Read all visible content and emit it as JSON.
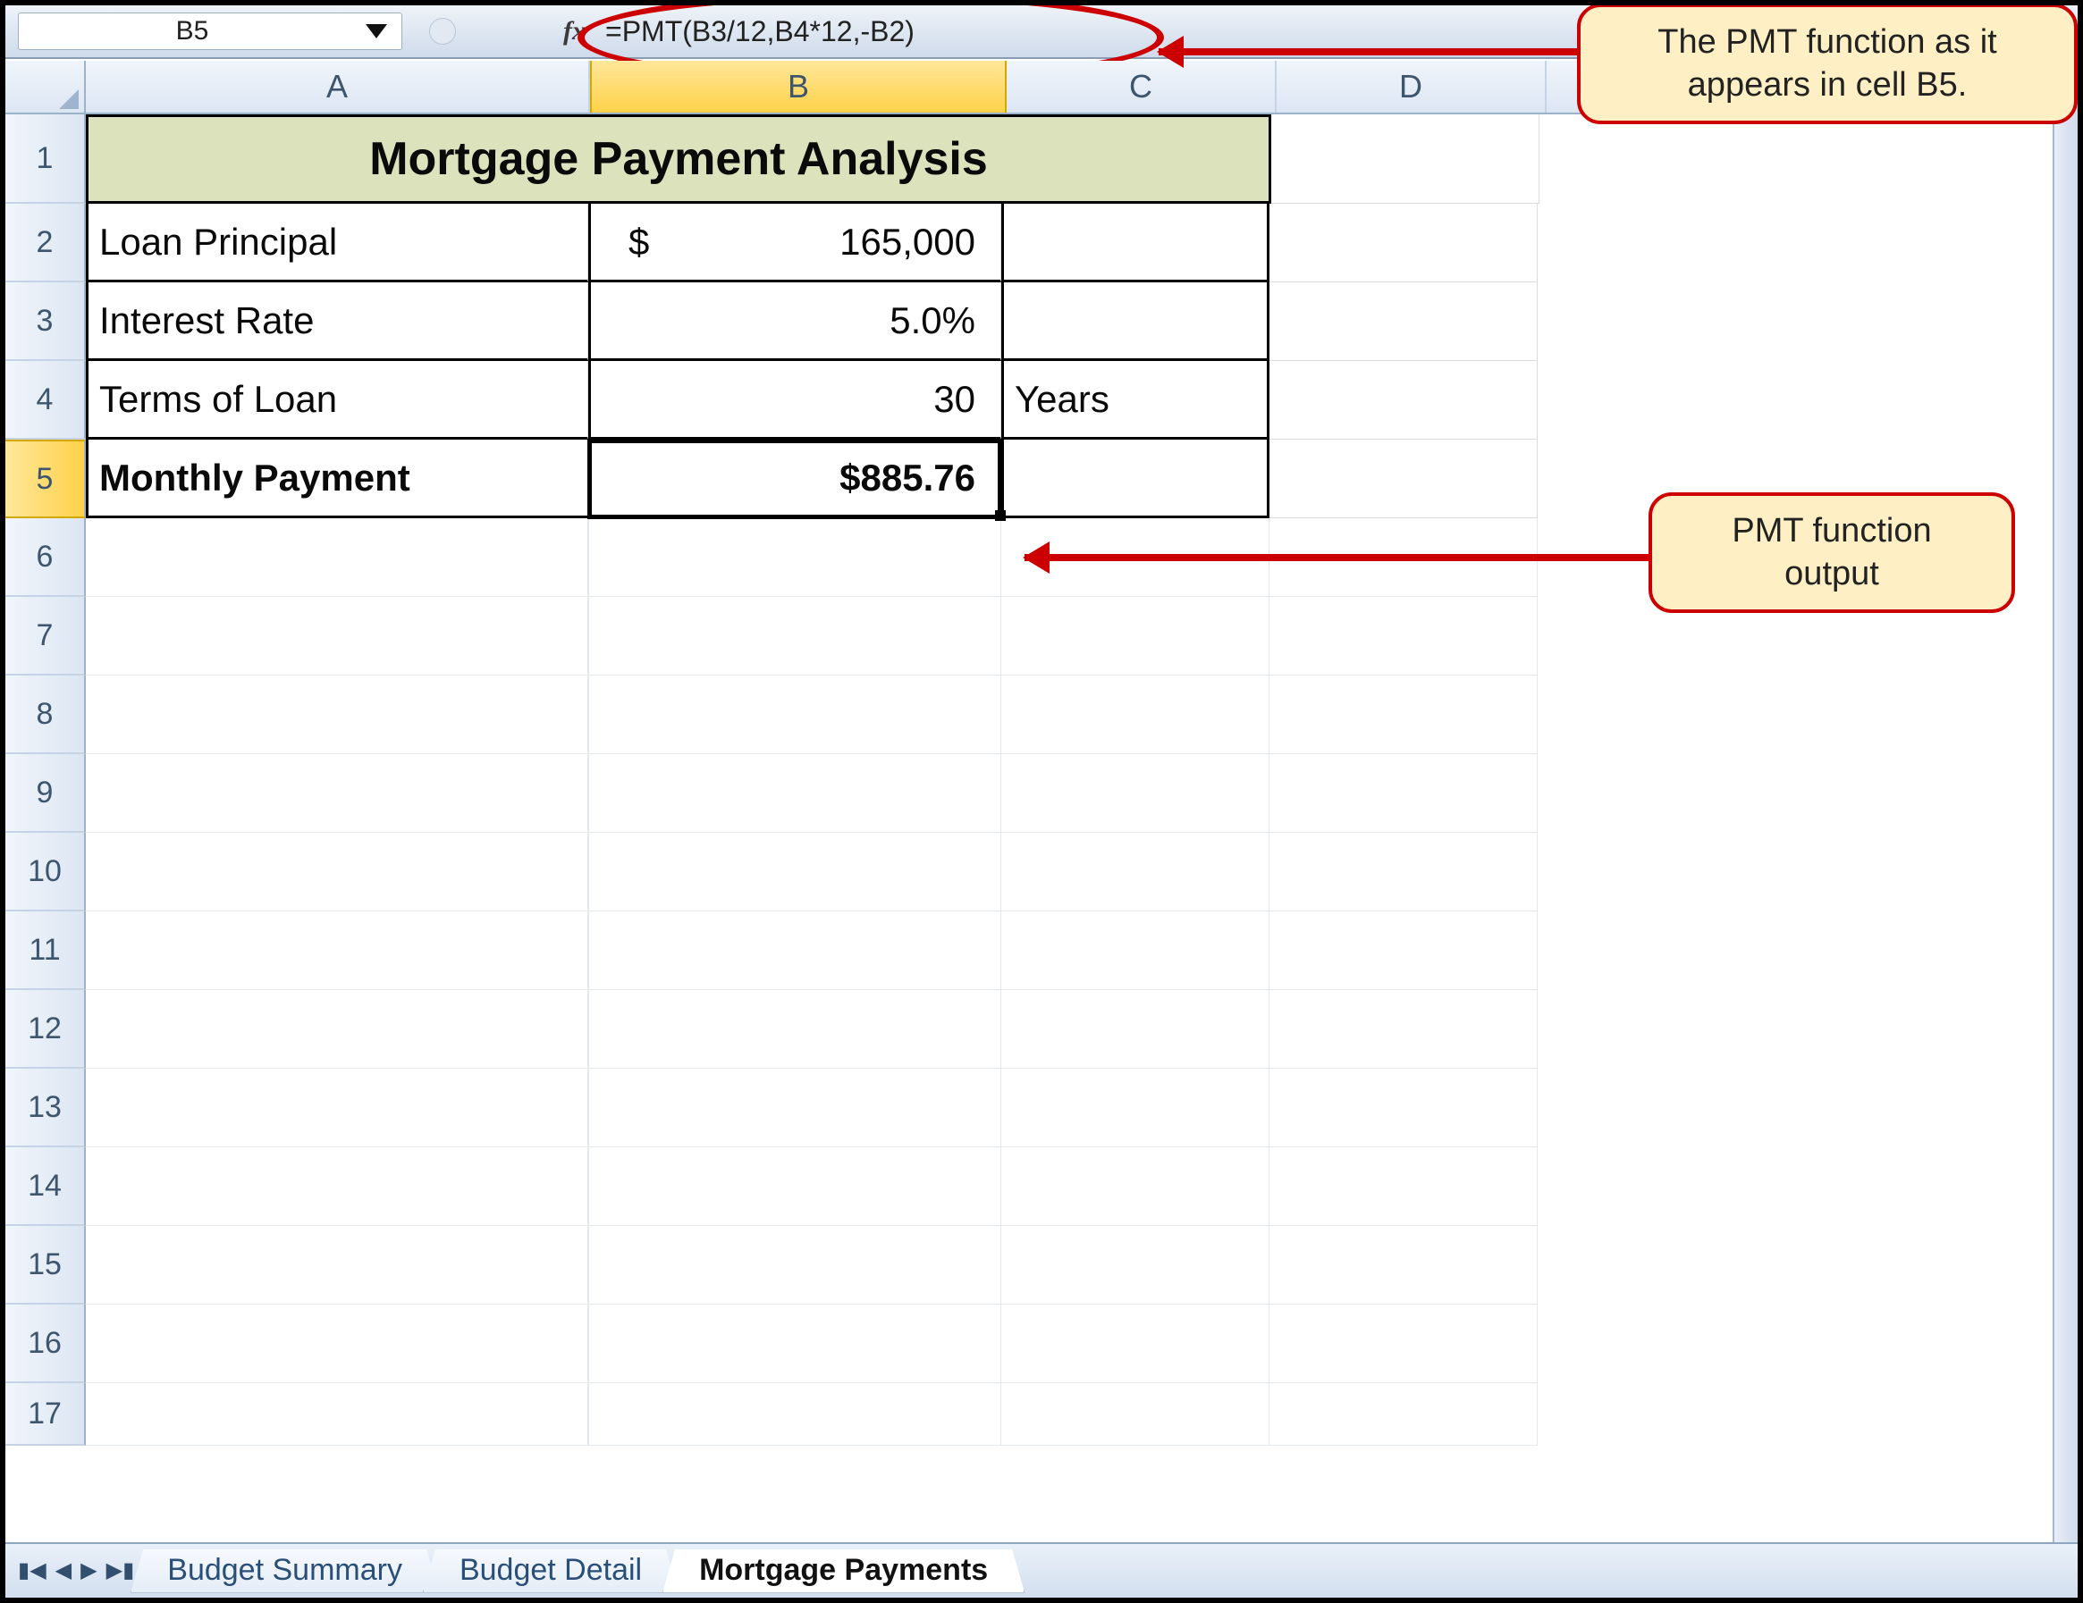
{
  "formula_bar": {
    "name_box": "B5",
    "fx_label": "fx",
    "formula": "=PMT(B3/12,B4*12,-B2)"
  },
  "columns": {
    "A": "A",
    "B": "B",
    "C": "C",
    "D": "D"
  },
  "row_numbers": [
    "1",
    "2",
    "3",
    "4",
    "5",
    "6",
    "7",
    "8",
    "9",
    "10",
    "11",
    "12",
    "13",
    "14",
    "15",
    "16",
    "17"
  ],
  "sheet": {
    "title": "Mortgage Payment Analysis",
    "rows": {
      "r2": {
        "label": "Loan Principal",
        "currency": "$",
        "value": "165,000",
        "extra": ""
      },
      "r3": {
        "label": "Interest Rate",
        "value": "5.0%",
        "extra": ""
      },
      "r4": {
        "label": "Terms of Loan",
        "value": "30",
        "extra": "Years"
      },
      "r5": {
        "label": "Monthly Payment",
        "value": "$885.76",
        "extra": ""
      }
    }
  },
  "tabs": {
    "t1": "Budget Summary",
    "t2": "Budget Detail",
    "t3": "Mortgage Payments"
  },
  "callouts": {
    "c1": "The PMT function as it appears in cell B5.",
    "c2": "PMT function output"
  },
  "chart_data": {
    "type": "table",
    "title": "Mortgage Payment Analysis",
    "rows": [
      {
        "label": "Loan Principal",
        "value": 165000,
        "display": "$ 165,000"
      },
      {
        "label": "Interest Rate",
        "value": 0.05,
        "display": "5.0%"
      },
      {
        "label": "Terms of Loan",
        "value": 30,
        "unit": "Years"
      },
      {
        "label": "Monthly Payment",
        "value": 885.76,
        "display": "$885.76",
        "formula": "=PMT(B3/12,B4*12,-B2)"
      }
    ]
  }
}
